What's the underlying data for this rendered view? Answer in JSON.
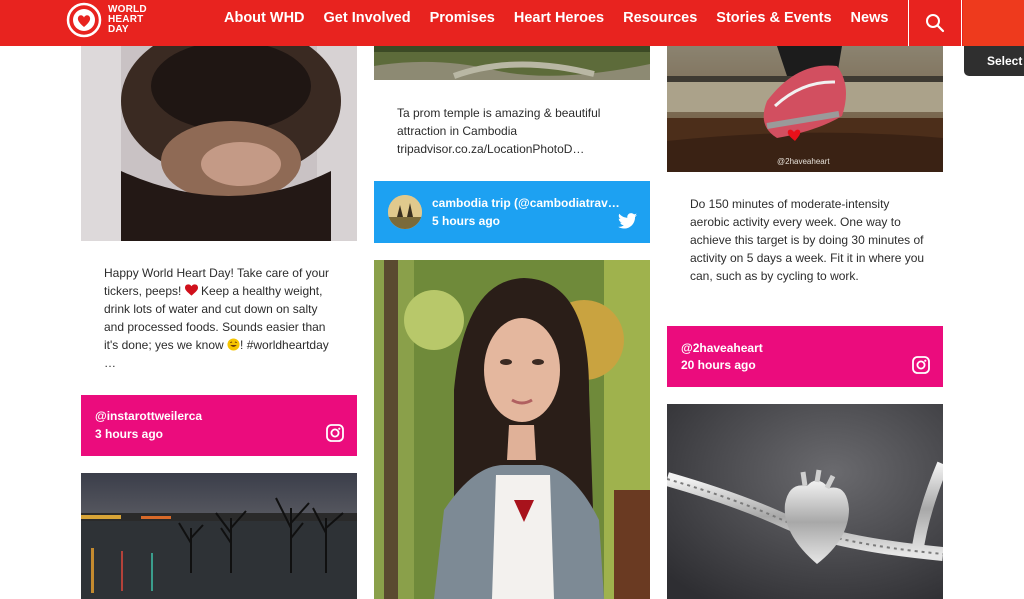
{
  "brand": {
    "logo_lines": [
      "WORLD",
      "HEART",
      "DAY"
    ],
    "accent": "#e8231f",
    "instagram_color": "#eb0c7d",
    "twitter_color": "#1da1f2"
  },
  "nav": {
    "items": [
      "About WHD",
      "Get Involved",
      "Promises",
      "Heart Heroes",
      "Resources",
      "Stories & Events",
      "News"
    ],
    "search_icon": "search-icon"
  },
  "select_chip": "Select",
  "feed": {
    "col1": {
      "post1": {
        "text_a": "Happy World Heart Day! Take care of your tickers, peeps! ",
        "text_b": " Keep a healthy weight, drink lots of water and cut down on salty and processed foods. Sounds easier than it's done; yes we know ",
        "text_c": "! #worldheartday …",
        "handle": "@instarottweilerca",
        "time": "3 hours ago",
        "network": "instagram"
      }
    },
    "col2": {
      "post1": {
        "text": "Ta prom temple is amazing & beautiful attraction in Cambodia tripadvisor.co.za/LocationPhotoD…",
        "handle": "cambodia trip (@cambodiatrav…",
        "time": "5 hours ago",
        "network": "twitter"
      }
    },
    "col3": {
      "post1": {
        "image_watermark": "@2haveaheart",
        "text": "Do 150 minutes of moderate-intensity aerobic activity every week. One way to achieve this target is by doing 30 minutes of activity on 5 days a week. Fit it in where you can, such as by cycling to work.",
        "handle": "@2haveaheart",
        "time": "20 hours ago",
        "network": "instagram"
      }
    }
  }
}
